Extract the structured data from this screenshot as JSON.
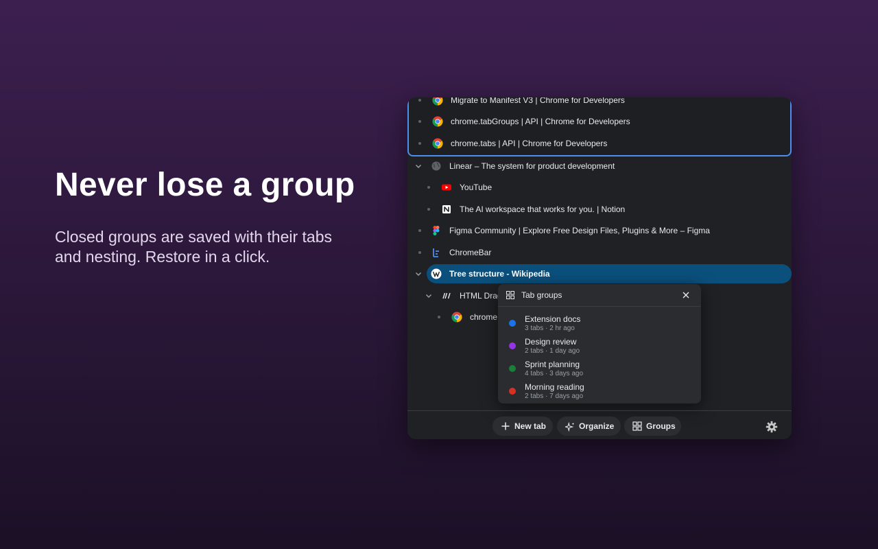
{
  "hero": {
    "headline": "Never lose a group",
    "subline": "Closed groups are saved with their tabs and nesting. Restore in a click."
  },
  "colors": {
    "accent_blue": "#4d8ff0",
    "selected_bg": "#0b4f7c",
    "panel_bg": "#202124"
  },
  "tree": {
    "group_tabs": [
      {
        "title": "Migrate to Manifest V3  |  Chrome for Developers",
        "icon": "chrome-icon"
      },
      {
        "title": "chrome.tabGroups  |  API  |  Chrome for Developers",
        "icon": "chrome-icon"
      },
      {
        "title": "chrome.tabs  |  API  |  Chrome for Developers",
        "icon": "chrome-icon"
      }
    ],
    "tabs": [
      {
        "title": "Linear – The system for product development",
        "icon": "globe-icon"
      },
      {
        "title": "YouTube",
        "icon": "youtube-icon"
      },
      {
        "title": "The AI workspace that works for you. | Notion",
        "icon": "notion-icon"
      },
      {
        "title": "Figma Community | Explore Free Design Files, Plugins & More – Figma",
        "icon": "figma-icon"
      },
      {
        "title": "ChromeBar",
        "icon": "chromebar-icon"
      },
      {
        "title": "Tree structure - Wikipedia",
        "icon": "wikipedia-icon"
      },
      {
        "title": "HTML Drag",
        "icon": "mdn-icon"
      },
      {
        "title": "chrome",
        "icon": "chrome-icon"
      }
    ]
  },
  "popup": {
    "title": "Tab groups",
    "groups": [
      {
        "name": "Extension docs",
        "meta": "3 tabs · 2 hr ago",
        "color": "#1a73e8"
      },
      {
        "name": "Design review",
        "meta": "2 tabs · 1 day ago",
        "color": "#9334e6"
      },
      {
        "name": "Sprint planning",
        "meta": "4 tabs · 3 days ago",
        "color": "#188038"
      },
      {
        "name": "Morning reading",
        "meta": "2 tabs · 7 days ago",
        "color": "#d93025"
      }
    ]
  },
  "footer": {
    "new_tab": "New tab",
    "organize": "Organize",
    "groups": "Groups"
  }
}
